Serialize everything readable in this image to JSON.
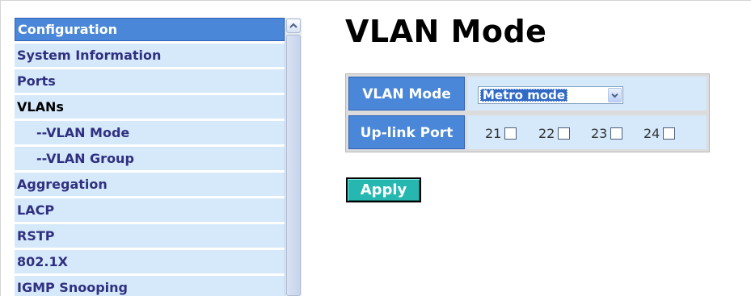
{
  "nav": {
    "items": [
      {
        "label": "Configuration",
        "type": "header"
      },
      {
        "label": "System Information",
        "type": "item"
      },
      {
        "label": "Ports",
        "type": "item"
      },
      {
        "label": "VLANs",
        "type": "active"
      },
      {
        "label": "--VLAN Mode",
        "type": "sub"
      },
      {
        "label": "--VLAN Group",
        "type": "sub"
      },
      {
        "label": "Aggregation",
        "type": "item"
      },
      {
        "label": "LACP",
        "type": "item"
      },
      {
        "label": "RSTP",
        "type": "item"
      },
      {
        "label": "802.1X",
        "type": "item"
      },
      {
        "label": "IGMP Snooping",
        "type": "item"
      }
    ],
    "scrollbar": {
      "up_icon": "chevron-up-icon"
    }
  },
  "page": {
    "title": "VLAN Mode",
    "form": {
      "vlan_mode_label": "VLAN Mode",
      "vlan_mode_value": "Metro mode",
      "uplink_label": "Up-link Port",
      "ports": [
        "21",
        "22",
        "23",
        "24"
      ]
    },
    "apply_label": "Apply"
  },
  "colors": {
    "header_blue": "#4a87d8",
    "cell_light_blue": "#d5e9fb",
    "nav_text": "#303080",
    "apply_teal": "#26b8b0",
    "select_highlight": "#316ac5"
  }
}
